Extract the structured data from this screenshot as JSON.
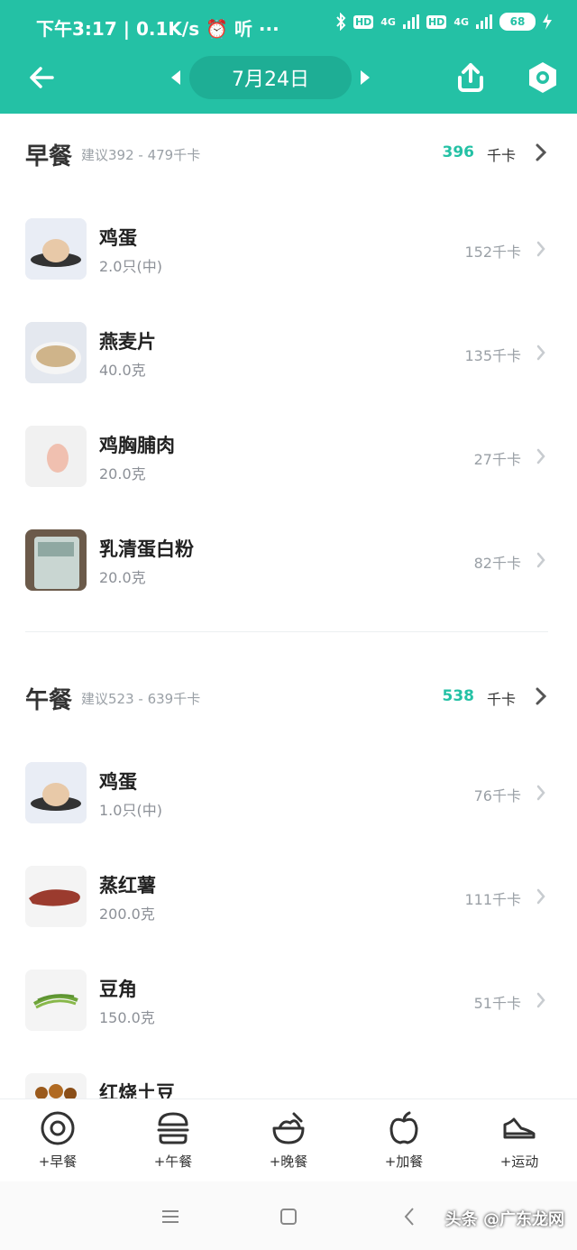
{
  "status_bar": {
    "left_text": "下午3:17 | 0.1K/s ⏰ 听 ···",
    "sim1_badge": "HD",
    "sim1_type": "4G",
    "sim2_badge": "HD",
    "sim2_type": "4G",
    "battery": "68"
  },
  "header": {
    "date": "7月24日",
    "accent_color": "#24c1a5"
  },
  "breakfast": {
    "title": "早餐",
    "suggestion": "建议392 - 479千卡",
    "total": "396",
    "unit": "千卡",
    "items": [
      {
        "name": "鸡蛋",
        "amount": "2.0只(中)",
        "kcal": "152千卡",
        "icon": "egg-image"
      },
      {
        "name": "燕麦片",
        "amount": "40.0克",
        "kcal": "135千卡",
        "icon": "oatmeal-image"
      },
      {
        "name": "鸡胸脯肉",
        "amount": "20.0克",
        "kcal": "27千卡",
        "icon": "chicken-breast-image"
      },
      {
        "name": "乳清蛋白粉",
        "amount": "20.0克",
        "kcal": "82千卡",
        "icon": "whey-protein-image"
      }
    ]
  },
  "lunch": {
    "title": "午餐",
    "suggestion": "建议523 - 639千卡",
    "total": "538",
    "unit": "千卡",
    "items": [
      {
        "name": "鸡蛋",
        "amount": "1.0只(中)",
        "kcal": "76千卡",
        "icon": "egg-image"
      },
      {
        "name": "蒸红薯",
        "amount": "200.0克",
        "kcal": "111千卡",
        "icon": "sweet-potato-image"
      },
      {
        "name": "豆角",
        "amount": "150.0克",
        "kcal": "51千卡",
        "icon": "green-beans-image"
      },
      {
        "name": "红烧土豆",
        "amount": "",
        "kcal": "",
        "icon": "braised-potato-image"
      }
    ]
  },
  "bottom_tabs": [
    {
      "label": "+早餐",
      "icon": "breakfast-egg-icon"
    },
    {
      "label": "+午餐",
      "icon": "burger-icon"
    },
    {
      "label": "+晚餐",
      "icon": "bowl-icon"
    },
    {
      "label": "+加餐",
      "icon": "apple-icon"
    },
    {
      "label": "+运动",
      "icon": "sneaker-icon"
    }
  ],
  "watermark": "头条 @广东龙网"
}
